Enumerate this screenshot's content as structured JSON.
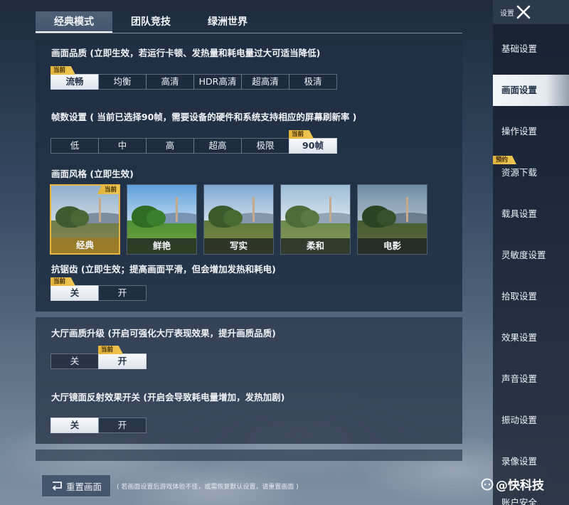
{
  "tabs": [
    {
      "label": "经典模式",
      "active": true
    },
    {
      "label": "团队竞技",
      "active": false
    },
    {
      "label": "绿洲世界",
      "active": false
    }
  ],
  "current_badge": "当前",
  "quality": {
    "title": "画面品质 (立即生效，若运行卡顿、发热量和耗电量过大可适当降低)",
    "options": [
      "流畅",
      "均衡",
      "高清",
      "HDR高清",
      "超高清",
      "极清"
    ],
    "selected": 0
  },
  "fps": {
    "title": "帧数设置 ( 当前已选择90帧，需要设备的硬件和系统支持相应的屏幕刷新率 )",
    "options": [
      "低",
      "中",
      "高",
      "超高",
      "极限",
      "90帧"
    ],
    "selected": 5
  },
  "style": {
    "title": "画面风格 (立即生效)",
    "options": [
      "经典",
      "鲜艳",
      "写实",
      "柔和",
      "电影"
    ],
    "selected": 0
  },
  "antialias": {
    "title": "抗锯齿 (立即生效；提高画面平滑，但会增加发热和耗电)",
    "options": [
      "关",
      "开"
    ],
    "selected": 0
  },
  "lobby_upgrade": {
    "title": "大厅画质升级 (开启可强化大厅表现效果，提升画质品质)",
    "options": [
      "关",
      "开"
    ],
    "selected": 1
  },
  "lobby_reflection": {
    "title": "大厅镜面反射效果开关 (开启会导致耗电量增加，发热加剧)",
    "options": [
      "关",
      "开"
    ],
    "selected": 0
  },
  "reset": {
    "label": "重置画面",
    "note": "( 若画面设置后游戏体验不佳，或需恢复默认设置，请重置画面 )"
  },
  "sidebar": {
    "title": "设置",
    "items": [
      {
        "label": "基础设置"
      },
      {
        "label": "画面设置",
        "active": true
      },
      {
        "label": "操作设置"
      },
      {
        "label": "资源下载",
        "badge": "预约"
      },
      {
        "label": "载具设置"
      },
      {
        "label": "灵敏度设置"
      },
      {
        "label": "拾取设置"
      },
      {
        "label": "效果设置"
      },
      {
        "label": "声音设置"
      },
      {
        "label": "振动设置"
      },
      {
        "label": "录像设置"
      },
      {
        "label": "账户安全"
      }
    ]
  },
  "watermark": "@快科技"
}
